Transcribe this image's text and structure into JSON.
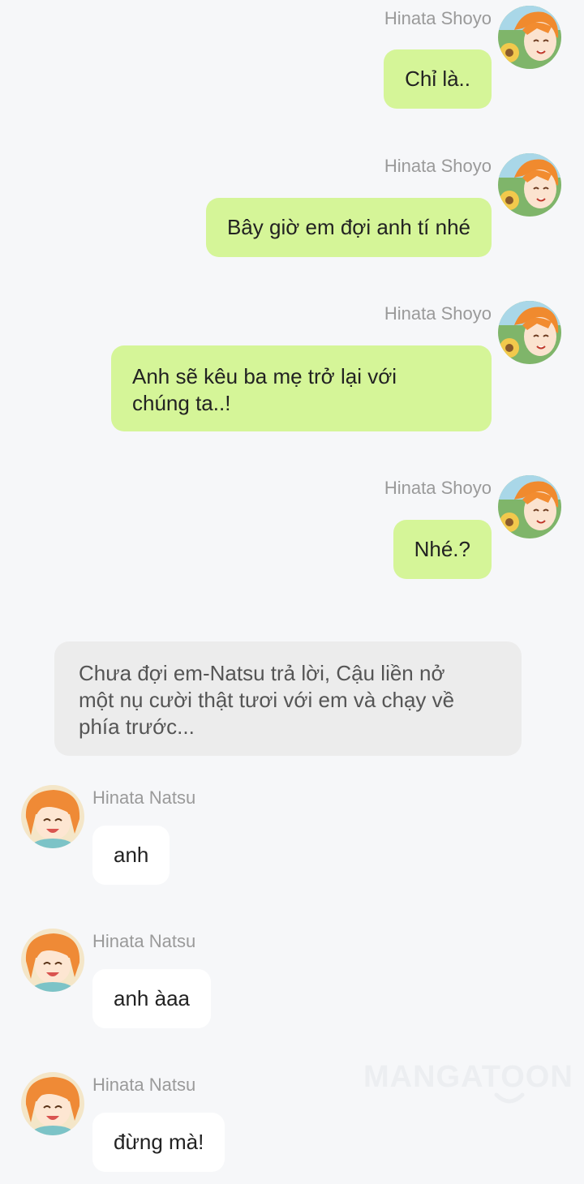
{
  "messages": [
    {
      "sender": "Hinata Shoyo",
      "text": "Chỉ là..",
      "side": "right"
    },
    {
      "sender": "Hinata Shoyo",
      "text": "Bây giờ em đợi anh tí nhé",
      "side": "right"
    },
    {
      "sender": "Hinata Shoyo",
      "text_line1": "Anh sẽ kêu ba mẹ trở lại với",
      "text_line2": "chúng ta..!",
      "side": "right"
    },
    {
      "sender": "Hinata Shoyo",
      "text": "Nhé.?",
      "side": "right"
    },
    {
      "sender": "Hinata Natsu",
      "text": "anh",
      "side": "left"
    },
    {
      "sender": "Hinata Natsu",
      "text": "anh àaa",
      "side": "left"
    },
    {
      "sender": "Hinata Natsu",
      "text": "đừng mà!",
      "side": "left"
    }
  ],
  "narration": {
    "line1": "Chưa đợi em-Natsu trả lời, Cậu liền nở",
    "line2": "một nụ cười thật tươi với em và chạy về",
    "line3": "phía trước..."
  },
  "watermark": "MANGATOON",
  "colors": {
    "background": "#f6f7f9",
    "outgoing_bubble": "#d5f598",
    "incoming_bubble": "#ffffff",
    "narration_bubble": "#ececec",
    "sender_name": "#9a9a9a"
  },
  "icons": {
    "shoyo_avatar": "shoyo-avatar-icon",
    "natsu_avatar": "natsu-avatar-icon"
  }
}
